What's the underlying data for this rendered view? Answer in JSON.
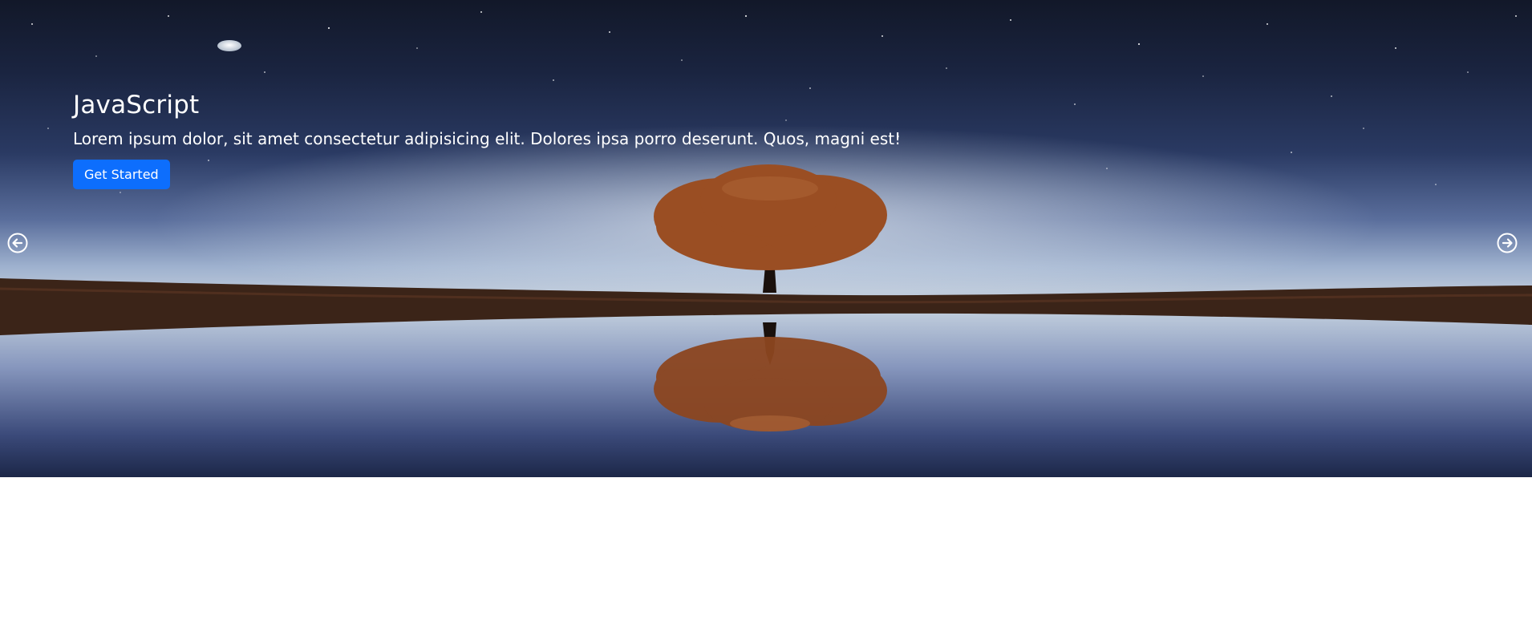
{
  "hero": {
    "title": "JavaScript",
    "subtitle": "Lorem ipsum dolor, sit amet consectetur adipisicing elit. Dolores ipsa porro deserunt. Quos, magni est!",
    "button_label": "Get Started"
  },
  "carousel": {
    "prev_icon": "arrow-left-circle-icon",
    "next_icon": "arrow-right-circle-icon"
  },
  "colors": {
    "accent": "#0d6efd",
    "sky_top": "#121829",
    "horizon": "#b9c6d8",
    "tree": "#9a4e23",
    "ground": "#3b2418"
  }
}
